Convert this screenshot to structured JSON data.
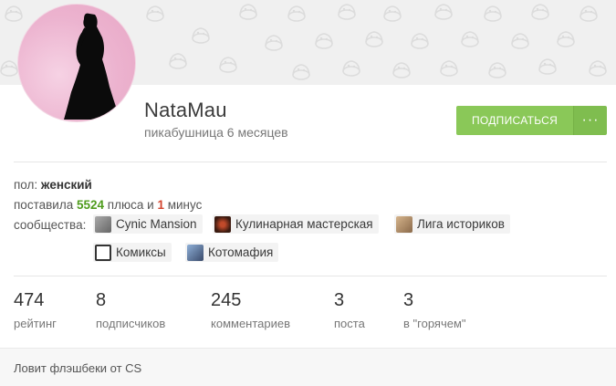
{
  "profile": {
    "username": "NataMau",
    "subtitle": "пикабушница 6 месяцев",
    "subscribe_label": "ПОДПИСАТЬСЯ",
    "more_label": "···"
  },
  "info": {
    "gender_label": "пол:",
    "gender_value": "женский",
    "votes_prefix": "поставила",
    "plus_count": "5524",
    "plus_word": "плюса и",
    "minus_count": "1",
    "minus_word": "минус",
    "communities_label": "сообщества:"
  },
  "communities": [
    {
      "name": "Cynic Mansion",
      "icon": "cynic-mansion-icon",
      "color": "#8a8a8a"
    },
    {
      "name": "Кулинарная мастерская",
      "icon": "cooking-icon",
      "color": "#5a2a1a"
    },
    {
      "name": "Лига историков",
      "icon": "history-icon",
      "color": "#b08a66"
    },
    {
      "name": "Комиксы",
      "icon": "comics-icon",
      "color": "#2a2a2a"
    },
    {
      "name": "Котомафия",
      "icon": "catmafia-icon",
      "color": "#4a6a9a"
    }
  ],
  "stats": [
    {
      "value": "474",
      "label": "рейтинг"
    },
    {
      "value": "8",
      "label": "подписчиков"
    },
    {
      "value": "245",
      "label": "комментариев"
    },
    {
      "value": "3",
      "label": "поста"
    },
    {
      "value": "3",
      "label": "в \"горячем\""
    }
  ],
  "bio": "Ловит флэшбеки от CS",
  "colors": {
    "accent_green": "#8ac858",
    "plus_green": "#4f9c1d",
    "minus_red": "#d3452f"
  }
}
